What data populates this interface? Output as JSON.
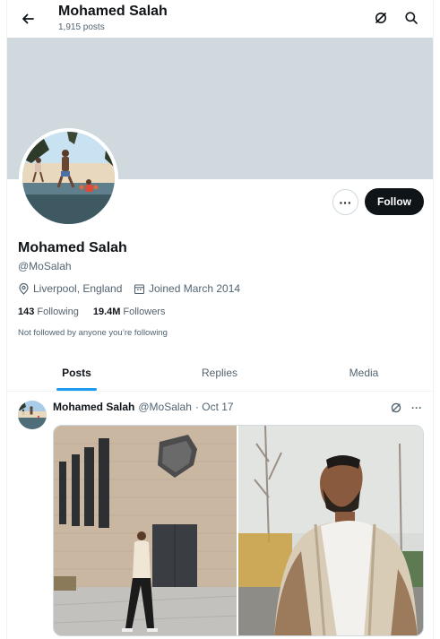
{
  "header": {
    "title": "Mohamed Salah",
    "posts_count": "1,915 posts",
    "back_icon": "arrow-left-icon",
    "grok_icon": "grok-icon",
    "search_icon": "search-icon"
  },
  "profile": {
    "name": "Mohamed Salah",
    "handle": "@MoSalah",
    "location": "Liverpool, England",
    "joined": "Joined March 2014",
    "following_count": "143",
    "following_label": "Following",
    "followers_count": "19.4M",
    "followers_label": "Followers",
    "followed_by_note": "Not followed by anyone you’re following",
    "more_label": "···",
    "follow_label": "Follow"
  },
  "tabs": [
    {
      "label": "Posts",
      "active": true
    },
    {
      "label": "Replies",
      "active": false
    },
    {
      "label": "Media",
      "active": false
    }
  ],
  "post": {
    "author_name": "Mohamed Salah",
    "author_handle": "@MoSalah",
    "date": "· Oct 17",
    "more_label": "···",
    "media_count": 2
  },
  "colors": {
    "accent": "#1d9bf0",
    "banner": "#cfd9de",
    "text_primary": "#0f1419",
    "text_secondary": "#536471",
    "follow_bg": "#0f1419"
  }
}
